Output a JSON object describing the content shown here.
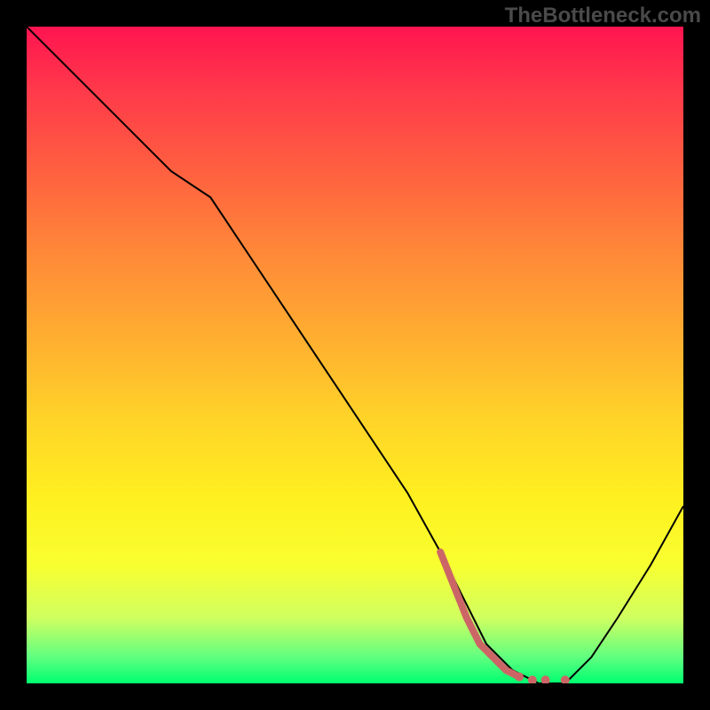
{
  "watermark": "TheBottleneck.com",
  "chart_data": {
    "type": "line",
    "title": "",
    "xlabel": "",
    "ylabel": "",
    "xlim": [
      0,
      100
    ],
    "ylim": [
      0,
      100
    ],
    "grid": false,
    "legend": false,
    "background_gradient": {
      "top_color": "#ff1450",
      "bottom_color": "#00ff70",
      "description": "vertical red-to-green through orange/yellow heat gradient"
    },
    "series": [
      {
        "name": "main-curve",
        "color": "#000000",
        "stroke_width": 2,
        "x": [
          0,
          8,
          16,
          22,
          28,
          34,
          40,
          46,
          52,
          58,
          63,
          67,
          70,
          74,
          78,
          82,
          86,
          90,
          95,
          100
        ],
        "values": [
          100,
          92,
          84,
          78,
          74,
          65,
          56,
          47,
          38,
          29,
          20,
          12,
          6,
          2,
          0,
          0,
          4,
          10,
          18,
          27
        ]
      },
      {
        "name": "highlight-segment",
        "color": "#cc6666",
        "stroke_width": 6,
        "style": "thick with dots near end",
        "x": [
          63,
          65,
          67,
          69,
          71,
          73,
          75,
          77,
          79,
          82
        ],
        "values": [
          20,
          15,
          10,
          6,
          4,
          2,
          1,
          0.5,
          0.5,
          0.5
        ]
      }
    ]
  }
}
